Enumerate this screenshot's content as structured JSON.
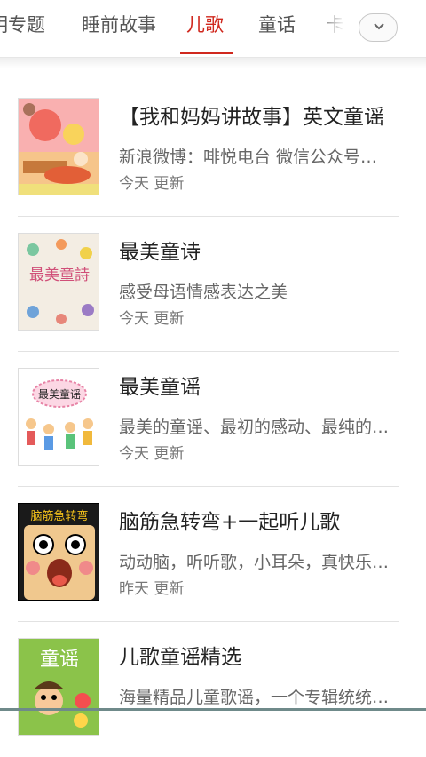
{
  "tabs": [
    {
      "label": "明专题"
    },
    {
      "label": "睡前故事"
    },
    {
      "label": "儿歌"
    },
    {
      "label": "童话"
    },
    {
      "label": "卡"
    }
  ],
  "active_tab": "儿歌",
  "accent_color": "#d0281e",
  "more_button_icon": "chevron-down-icon",
  "items": [
    {
      "title": "【我和妈妈讲故事】英文童谣",
      "desc": "新浪微博：啡悦电台 微信公众号…",
      "time": "今天 更新"
    },
    {
      "title": "最美童诗",
      "desc": "感受母语情感表达之美",
      "time": "今天 更新",
      "thumb_text": "最美童詩"
    },
    {
      "title": "最美童谣",
      "desc": "最美的童谣、最初的感动、最纯的…",
      "time": "今天 更新",
      "thumb_text": "最美童谣"
    },
    {
      "title": "脑筋急转弯+一起听儿歌",
      "desc": "动动脑，听听歌，小耳朵，真快乐…",
      "time": "昨天 更新",
      "thumb_text": "脑筋急转弯"
    },
    {
      "title": "儿歌童谣精选",
      "desc": "海量精品儿童歌谣，一个专辑统统…",
      "time": "",
      "thumb_text": "童谣"
    }
  ]
}
